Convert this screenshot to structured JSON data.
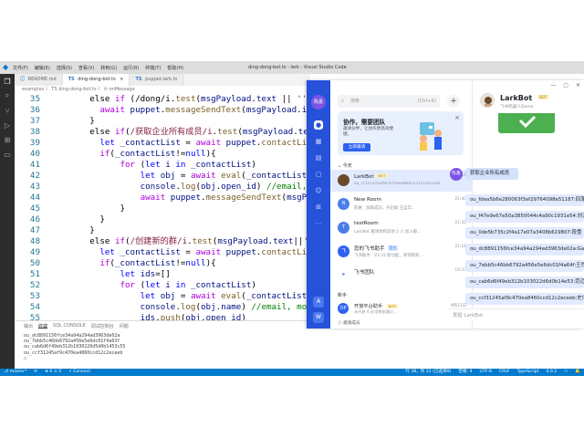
{
  "vscode": {
    "title": "ding-dong-bot.ts - lark - Visual Studio Code",
    "menu": [
      "文件(F)",
      "编辑(E)",
      "选择(S)",
      "查看(V)",
      "转到(G)",
      "运行(R)",
      "终端(T)",
      "帮助(H)"
    ],
    "tabs": [
      {
        "label": "README.md",
        "prefix": "ⓘ"
      },
      {
        "label": "ding-dong-bot.ts",
        "prefix": "TS"
      },
      {
        "label": "puppet-lark.ts",
        "prefix": "TS"
      }
    ],
    "breadcrumb": "examples 〉 TS ding-dong-bot.ts 〉 ⟳ onMessage",
    "code_lines": [
      {
        "n": "35",
        "indent": 4,
        "tokens": [
          [
            "p",
            "else "
          ],
          [
            "ctl",
            "if "
          ],
          [
            "p",
            "(/dong/i."
          ],
          [
            "fn",
            "test"
          ],
          [
            "p",
            "("
          ],
          [
            "var",
            "msgPayload"
          ],
          [
            "p",
            "."
          ],
          [
            "var",
            "text"
          ],
          [
            "p",
            " || "
          ],
          [
            "str",
            "''"
          ],
          [
            "p",
            ")) {"
          ]
        ]
      },
      {
        "n": "36",
        "indent": 5,
        "tokens": [
          [
            "ctl",
            "await "
          ],
          [
            "var",
            "puppet"
          ],
          [
            "p",
            "."
          ],
          [
            "fn",
            "messageSendText"
          ],
          [
            "p",
            "("
          ],
          [
            "var",
            "msgPayload"
          ],
          [
            "p",
            "."
          ],
          [
            "var",
            "id"
          ],
          [
            "p",
            "!, "
          ],
          [
            "str",
            "\"dong\""
          ],
          [
            "p",
            ")"
          ]
        ]
      },
      {
        "n": "37",
        "indent": 4,
        "tokens": [
          [
            "p",
            "}"
          ]
        ]
      },
      {
        "n": "38",
        "indent": 4,
        "tokens": [
          [
            "p",
            "else "
          ],
          [
            "ctl",
            "if"
          ],
          [
            "p",
            "("
          ],
          [
            "re",
            "/获取企业所有成员/i"
          ],
          [
            "p",
            "."
          ],
          [
            "fn",
            "test"
          ],
          [
            "p",
            "("
          ],
          [
            "var",
            "msgPayload"
          ],
          [
            "p",
            "."
          ],
          [
            "var",
            "text"
          ],
          [
            "p",
            "||"
          ],
          [
            "str",
            "''"
          ],
          [
            "p",
            ")){"
          ]
        ]
      },
      {
        "n": "39",
        "indent": 5,
        "tokens": [
          [
            "kw",
            "let "
          ],
          [
            "var",
            "_contactList"
          ],
          [
            "p",
            " = "
          ],
          [
            "ctl",
            "await "
          ],
          [
            "var",
            "puppet"
          ],
          [
            "p",
            "."
          ],
          [
            "fn",
            "contactList"
          ],
          [
            "p",
            "()."
          ],
          [
            "fn",
            "catch"
          ],
          [
            "p",
            "(co"
          ]
        ]
      },
      {
        "n": "40",
        "indent": 5,
        "tokens": [
          [
            "ctl",
            "if"
          ],
          [
            "p",
            "("
          ],
          [
            "var",
            "_contactList"
          ],
          [
            "p",
            "!="
          ],
          [
            "kw",
            "null"
          ],
          [
            "p",
            "){"
          ]
        ]
      },
      {
        "n": "41",
        "indent": 7,
        "tokens": [
          [
            "ctl",
            "for "
          ],
          [
            "p",
            "("
          ],
          [
            "kw",
            "let "
          ],
          [
            "var",
            "i "
          ],
          [
            "kw",
            "in "
          ],
          [
            "var",
            "_contactList"
          ],
          [
            "p",
            ")"
          ]
        ]
      },
      {
        "n": "42",
        "indent": 9,
        "tokens": [
          [
            "kw",
            "let "
          ],
          [
            "var",
            "obj"
          ],
          [
            "p",
            " = "
          ],
          [
            "ctl",
            "await "
          ],
          [
            "fn",
            "eval"
          ],
          [
            "p",
            "("
          ],
          [
            "var",
            "_contactList"
          ],
          [
            "p",
            "["
          ],
          [
            "var",
            "i"
          ],
          [
            "p",
            "])"
          ]
        ]
      },
      {
        "n": "43",
        "indent": 9,
        "tokens": [
          [
            "var",
            "console"
          ],
          [
            "p",
            "."
          ],
          [
            "fn",
            "log"
          ],
          [
            "p",
            "("
          ],
          [
            "var",
            "obj"
          ],
          [
            "p",
            "."
          ],
          [
            "var",
            "open_id"
          ],
          [
            "p",
            ") "
          ],
          [
            "cm",
            "//email, mobile, open"
          ]
        ]
      },
      {
        "n": "44",
        "indent": 9,
        "tokens": [
          [
            "ctl",
            "await "
          ],
          [
            "var",
            "puppet"
          ],
          [
            "p",
            "."
          ],
          [
            "fn",
            "messageSendText"
          ],
          [
            "p",
            "("
          ],
          [
            "var",
            "msgPayload"
          ],
          [
            "p",
            "."
          ],
          [
            "var",
            "id"
          ],
          [
            "p",
            "!, "
          ],
          [
            "var",
            "obj"
          ],
          [
            "p",
            "."
          ],
          [
            "var",
            "open"
          ]
        ]
      },
      {
        "n": "45",
        "indent": 7,
        "tokens": [
          [
            "p",
            "}"
          ]
        ]
      },
      {
        "n": "46",
        "indent": 5,
        "tokens": [
          [
            "p",
            "}"
          ]
        ]
      },
      {
        "n": "47",
        "indent": 4,
        "tokens": [
          [
            "p",
            "}"
          ]
        ]
      },
      {
        "n": "48",
        "indent": 4,
        "tokens": [
          [
            "p",
            "else "
          ],
          [
            "ctl",
            "if"
          ],
          [
            "p",
            "("
          ],
          [
            "re",
            "/创建新的群/i"
          ],
          [
            "p",
            "."
          ],
          [
            "fn",
            "test"
          ],
          [
            "p",
            "("
          ],
          [
            "var",
            "msgPayload"
          ],
          [
            "p",
            "."
          ],
          [
            "var",
            "text"
          ],
          [
            "p",
            "||"
          ],
          [
            "str",
            "''"
          ],
          [
            "p",
            ")){"
          ]
        ]
      },
      {
        "n": "49",
        "indent": 5,
        "tokens": [
          [
            "kw",
            "let "
          ],
          [
            "var",
            "_contactList"
          ],
          [
            "p",
            " = "
          ],
          [
            "ctl",
            "await "
          ],
          [
            "var",
            "puppet"
          ],
          [
            "p",
            "."
          ],
          [
            "fn",
            "contactList"
          ],
          [
            "p",
            "()."
          ],
          [
            "fn",
            "catch"
          ],
          [
            "p",
            "(co"
          ]
        ]
      },
      {
        "n": "50",
        "indent": 5,
        "tokens": [
          [
            "ctl",
            "if"
          ],
          [
            "p",
            "("
          ],
          [
            "var",
            "_contactList"
          ],
          [
            "p",
            "!="
          ],
          [
            "kw",
            "null"
          ],
          [
            "p",
            "){"
          ]
        ]
      },
      {
        "n": "51",
        "indent": 7,
        "tokens": [
          [
            "kw",
            "let "
          ],
          [
            "var",
            "ids"
          ],
          [
            "p",
            "=[]"
          ]
        ]
      },
      {
        "n": "52",
        "indent": 7,
        "tokens": [
          [
            "ctl",
            "for "
          ],
          [
            "p",
            "("
          ],
          [
            "kw",
            "let "
          ],
          [
            "var",
            "i "
          ],
          [
            "kw",
            "in "
          ],
          [
            "var",
            "_contactList"
          ],
          [
            "p",
            ")"
          ]
        ]
      },
      {
        "n": "53",
        "indent": 9,
        "tokens": [
          [
            "kw",
            "let "
          ],
          [
            "var",
            "obj"
          ],
          [
            "p",
            " = "
          ],
          [
            "ctl",
            "await "
          ],
          [
            "fn",
            "eval"
          ],
          [
            "p",
            "("
          ],
          [
            "var",
            "_contactList"
          ],
          [
            "p",
            "["
          ],
          [
            "var",
            "i"
          ],
          [
            "p",
            "])"
          ]
        ]
      },
      {
        "n": "54",
        "indent": 9,
        "tokens": [
          [
            "var",
            "console"
          ],
          [
            "p",
            "."
          ],
          [
            "fn",
            "log"
          ],
          [
            "p",
            "("
          ],
          [
            "var",
            "obj"
          ],
          [
            "p",
            "."
          ],
          [
            "var",
            "name"
          ],
          [
            "p",
            ") "
          ],
          [
            "cm",
            "//email, mobile, open_id"
          ]
        ]
      },
      {
        "n": "55",
        "indent": 9,
        "tokens": [
          [
            "var",
            "ids"
          ],
          [
            "p",
            "."
          ],
          [
            "fn",
            "push"
          ],
          [
            "p",
            "("
          ],
          [
            "var",
            "obj"
          ],
          [
            "p",
            "."
          ],
          [
            "var",
            "open_id"
          ],
          [
            "p",
            ")"
          ]
        ]
      }
    ],
    "panel_tabs": [
      "输出",
      "终端",
      "SQL CONSOLE",
      "调试控制台",
      "问题"
    ],
    "terminal_lines": [
      "ou_dc8891156fce34a94a294ad3963de02a",
      "ou_7ebb5c46bb6792a456e5e6dc01f4a63f",
      "ou_cab6d6f49eb312b1030220d5d0b1453c55",
      "ou_ccf31245af9c470ea4860ccd12c2eceeb",
      "▯"
    ],
    "status_left": [
      "⎇ master*",
      "⟳",
      "⊗ 0 ⚠ 0",
      "⚡ Connect"
    ],
    "status_right": [
      "行 38，列 22 (已选择9)",
      "空格: 4",
      "UTF-8",
      "CRLF",
      "TypeScript",
      "4.0.2",
      "⚇",
      "🔔"
    ]
  },
  "lark": {
    "rail": {
      "avatar": "陈嘉",
      "icons": [
        "chat-bubble-icon",
        "calendar-icon",
        "doc-icon",
        "drive-icon",
        "contacts-icon",
        "workplace-icon",
        "more-icon"
      ]
    },
    "search": {
      "placeholder": "搜索",
      "shortcut": "(Ctrl+K)"
    },
    "banner": {
      "title": "协作，需要团队",
      "desc": "邀请伙伴，让协作更高效便捷。",
      "button": "立即邀请"
    },
    "section_head": "⌄ 今天",
    "chats": [
      {
        "name": "LarkBot",
        "tag": "BOT",
        "tag_color": "yellow",
        "preview": "ou_ccf31245af9c470ea4860ccd12c2eceeb",
        "time": "21:51",
        "avatar": "",
        "avatar_color": "#6b4a2a",
        "selected": true
      },
      {
        "name": "New Room",
        "tag": "",
        "preview": "陈嘉：加群成功，开启群 王自华...",
        "time": "21:40",
        "avatar": "N",
        "avatar_color": "#4a7ee8"
      },
      {
        "name": "testRoom",
        "tag": "",
        "preview": "LarkBot 邀请你和其他 5 人 加入群...",
        "time": "21:32",
        "avatar": "T",
        "avatar_color": "#4a7ee8"
      },
      {
        "name": "您的飞书助手",
        "tag": "官方",
        "tag_color": "blue",
        "preview": "飞书助手：V3.32 新功能，来领取新...",
        "time": "21:18",
        "avatar": "飞",
        "avatar_color": "#2d62f0"
      },
      {
        "name": "飞书团队",
        "tag": "",
        "preview": "",
        "time": "16:37",
        "avatar": "➤",
        "avatar_color": "#ffffff"
      }
    ],
    "foot_label": "新手",
    "foot_chat": {
      "name": "开放平台助手",
      "tag": "BOT",
      "preview": "未开启 4 应用审核通过...",
      "time": "9月21日",
      "avatar": "OP"
    },
    "bottom_label": "ⓘ 邀请成员",
    "conversation": {
      "name": "LarkBot",
      "tag": "BOT",
      "subtitle": "飞书机器人Demo",
      "my_avatar": "陈嘉",
      "my_message": "获取企业所有成员",
      "bot_messages": [
        "ou_fdea5b6e280063f3ef29764098e51187:四蒲",
        "ou_f47e9e67e50a3850044c4a90c1931e54:刘波",
        "ou_0de5b735c2f4a17e07a3408b619807:段雪",
        "ou_dc8891156fce34a94a294ad3963de02a:Gabr",
        "ou_7ebb5c46bb6792a456e5e6dc01f4a64f:王乔",
        "ou_cab6d6f49eb312b103022d6d0b14e53:范迈",
        "ou_ccf31245af9c470ea8460ccd12c2eceeb:史乐乐"
      ],
      "input_placeholder": "发给 LarkBot"
    },
    "window_controls": [
      "—",
      "▢",
      "✕"
    ]
  }
}
